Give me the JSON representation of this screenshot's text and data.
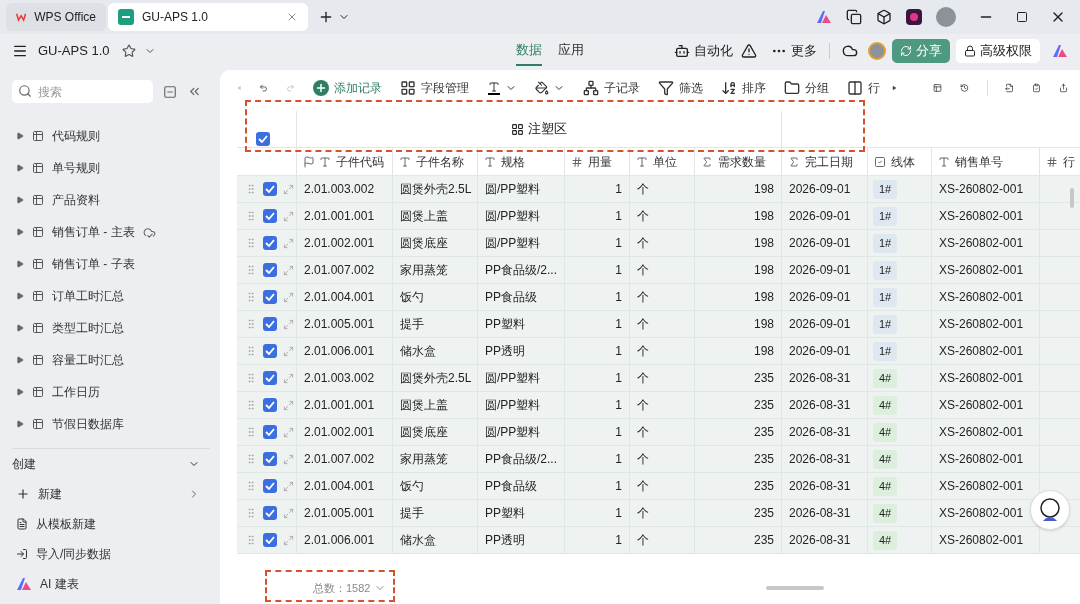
{
  "tabs": [
    {
      "label": "WPS Office",
      "kind": "wps",
      "selected": false
    },
    {
      "label": "GU-APS 1.0",
      "kind": "doc",
      "selected": true
    }
  ],
  "header": {
    "title": "GU-APS 1.0",
    "nav": [
      {
        "label": "数据",
        "selected": true
      },
      {
        "label": "应用",
        "selected": false
      }
    ],
    "automation": "自动化",
    "more": "更多",
    "share": "分享",
    "permission": "高级权限"
  },
  "sidebar": {
    "search_placeholder": "搜索",
    "items": [
      {
        "label": "代码规则",
        "synced": false
      },
      {
        "label": "单号规则",
        "synced": false
      },
      {
        "label": "产品资料",
        "synced": false
      },
      {
        "label": "销售订单 - 主表",
        "synced": true
      },
      {
        "label": "销售订单 - 子表",
        "synced": false
      },
      {
        "label": "订单工时汇总",
        "synced": false
      },
      {
        "label": "类型工时汇总",
        "synced": false
      },
      {
        "label": "容量工时汇总",
        "synced": false
      },
      {
        "label": "工作日历",
        "synced": false
      },
      {
        "label": "节假日数据库",
        "synced": false
      }
    ],
    "create_title": "创建",
    "create_items": [
      {
        "label": "新建",
        "kind": "new"
      },
      {
        "label": "从模板新建",
        "kind": "template"
      },
      {
        "label": "导入/同步数据",
        "kind": "import"
      },
      {
        "label": "AI 建表",
        "kind": "ai"
      }
    ]
  },
  "toolbar": [
    {
      "label": "添加记录",
      "kind": "add"
    },
    {
      "label": "字段管理",
      "kind": "fields"
    },
    {
      "kind": "text-color"
    },
    {
      "kind": "fill-color"
    },
    {
      "label": "子记录",
      "kind": "subrecord"
    },
    {
      "label": "筛选",
      "kind": "filter"
    },
    {
      "label": "排序",
      "kind": "sort"
    },
    {
      "label": "分组",
      "kind": "group"
    },
    {
      "label": "行",
      "kind": "row"
    }
  ],
  "table": {
    "group": "注塑区",
    "all_checked": true,
    "columns": [
      {
        "label": "子件代码",
        "kind": "primary"
      },
      {
        "label": "子件名称",
        "kind": "text"
      },
      {
        "label": "规格",
        "kind": "text"
      },
      {
        "label": "用量",
        "kind": "number"
      },
      {
        "label": "单位",
        "kind": "text"
      },
      {
        "label": "需求数量",
        "kind": "formula"
      },
      {
        "label": "完工日期",
        "kind": "formula"
      },
      {
        "label": "线体",
        "kind": "select"
      },
      {
        "label": "销售单号",
        "kind": "text"
      },
      {
        "label": "行",
        "kind": "number"
      }
    ],
    "rows": [
      {
        "checked": true,
        "cells": [
          "2.01.003.002",
          "圆煲外壳2.5L",
          "圆/PP塑料",
          "1",
          "个",
          "198",
          "2026-09-01"
        ],
        "line": {
          "label": "1#",
          "color": "#dfe7f1"
        },
        "order": "XS-260802-001"
      },
      {
        "checked": true,
        "cells": [
          "2.01.001.001",
          "圆煲上盖",
          "圆/PP塑料",
          "1",
          "个",
          "198",
          "2026-09-01"
        ],
        "line": {
          "label": "1#",
          "color": "#dfe7f1"
        },
        "order": "XS-260802-001"
      },
      {
        "checked": true,
        "cells": [
          "2.01.002.001",
          "圆煲底座",
          "圆/PP塑料",
          "1",
          "个",
          "198",
          "2026-09-01"
        ],
        "line": {
          "label": "1#",
          "color": "#dfe7f1"
        },
        "order": "XS-260802-001"
      },
      {
        "checked": true,
        "cells": [
          "2.01.007.002",
          "家用蒸笼",
          "PP食品级/2...",
          "1",
          "个",
          "198",
          "2026-09-01"
        ],
        "line": {
          "label": "1#",
          "color": "#dfe7f1"
        },
        "order": "XS-260802-001"
      },
      {
        "checked": true,
        "cells": [
          "2.01.004.001",
          "饭勺",
          "PP食品级",
          "1",
          "个",
          "198",
          "2026-09-01"
        ],
        "line": {
          "label": "1#",
          "color": "#dfe7f1"
        },
        "order": "XS-260802-001"
      },
      {
        "checked": true,
        "cells": [
          "2.01.005.001",
          "提手",
          "PP塑料",
          "1",
          "个",
          "198",
          "2026-09-01"
        ],
        "line": {
          "label": "1#",
          "color": "#dfe7f1"
        },
        "order": "XS-260802-001"
      },
      {
        "checked": true,
        "cells": [
          "2.01.006.001",
          "储水盒",
          "PP透明",
          "1",
          "个",
          "198",
          "2026-09-01"
        ],
        "line": {
          "label": "1#",
          "color": "#dfe7f1"
        },
        "order": "XS-260802-001"
      },
      {
        "checked": true,
        "cells": [
          "2.01.003.002",
          "圆煲外壳2.5L",
          "圆/PP塑料",
          "1",
          "个",
          "235",
          "2026-08-31"
        ],
        "line": {
          "label": "4#",
          "color": "#dcefdc"
        },
        "order": "XS-260802-001"
      },
      {
        "checked": true,
        "cells": [
          "2.01.001.001",
          "圆煲上盖",
          "圆/PP塑料",
          "1",
          "个",
          "235",
          "2026-08-31"
        ],
        "line": {
          "label": "4#",
          "color": "#dcefdc"
        },
        "order": "XS-260802-001"
      },
      {
        "checked": true,
        "cells": [
          "2.01.002.001",
          "圆煲底座",
          "圆/PP塑料",
          "1",
          "个",
          "235",
          "2026-08-31"
        ],
        "line": {
          "label": "4#",
          "color": "#dcefdc"
        },
        "order": "XS-260802-001"
      },
      {
        "checked": true,
        "cells": [
          "2.01.007.002",
          "家用蒸笼",
          "PP食品级/2...",
          "1",
          "个",
          "235",
          "2026-08-31"
        ],
        "line": {
          "label": "4#",
          "color": "#dcefdc"
        },
        "order": "XS-260802-001"
      },
      {
        "checked": true,
        "cells": [
          "2.01.004.001",
          "饭勺",
          "PP食品级",
          "1",
          "个",
          "235",
          "2026-08-31"
        ],
        "line": {
          "label": "4#",
          "color": "#dcefdc"
        },
        "order": "XS-260802-001"
      },
      {
        "checked": true,
        "cells": [
          "2.01.005.001",
          "提手",
          "PP塑料",
          "1",
          "个",
          "235",
          "2026-08-31"
        ],
        "line": {
          "label": "4#",
          "color": "#dcefdc"
        },
        "order": "XS-260802-001"
      },
      {
        "checked": true,
        "cells": [
          "2.01.006.001",
          "储水盒",
          "PP透明",
          "1",
          "个",
          "235",
          "2026-08-31"
        ],
        "line": {
          "label": "4#",
          "color": "#dcefdc"
        },
        "order": "XS-260802-001"
      }
    ],
    "total": "总数：1582"
  }
}
